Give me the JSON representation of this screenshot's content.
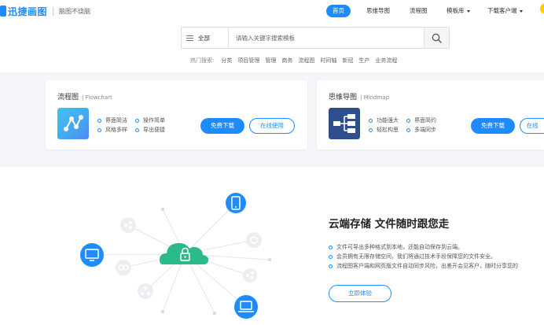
{
  "brand": {
    "name": "迅捷画图",
    "slogan": "脑图不烧脑"
  },
  "colors": {
    "accent": "#1e8cff",
    "cloud_green": "#2bba8a",
    "band_bg": "#f4f6fa"
  },
  "nav": {
    "items": [
      {
        "label": "首页",
        "active": true,
        "dropdown": false
      },
      {
        "label": "思维导图",
        "active": false,
        "dropdown": false
      },
      {
        "label": "流程图",
        "active": false,
        "dropdown": false
      },
      {
        "label": "模板库",
        "active": false,
        "dropdown": true
      },
      {
        "label": "下载客户端",
        "active": false,
        "dropdown": true
      }
    ]
  },
  "search": {
    "scope": "全部",
    "placeholder": "请输入关键字搜索模板",
    "value": "",
    "hot_label": "热门搜索:",
    "hot_terms": [
      "分类",
      "项目管理",
      "管理",
      "商务",
      "流程图",
      "时间轴",
      "新冠",
      "生产",
      "业务流程"
    ]
  },
  "cards": [
    {
      "title": "流程图",
      "subtitle": "Flowchart",
      "icon": "flowchart-icon",
      "features": [
        "界面简洁",
        "操作简单",
        "风格多样",
        "导出便捷"
      ],
      "download_label": "免费下载",
      "online_label": "在线使用"
    },
    {
      "title": "思维导图",
      "subtitle": "Mindmap",
      "icon": "mindmap-icon",
      "features": [
        "功能强大",
        "界面简约",
        "轻松构思",
        "多端同步"
      ],
      "download_label": "免费下载",
      "online_label": "在线"
    }
  ],
  "cloud": {
    "title": "云端存储  文件随时跟您走",
    "points": [
      "文件可导出多种格式到本地，还能自动保存到云端。",
      "会员拥有无限存储空间，我们将通过技术手段保障您的文件安全。",
      "流程图客户端和网页版文件自动同步风险，出差开会见客户，随时分享您的"
    ],
    "cta_label": "立即体验"
  }
}
